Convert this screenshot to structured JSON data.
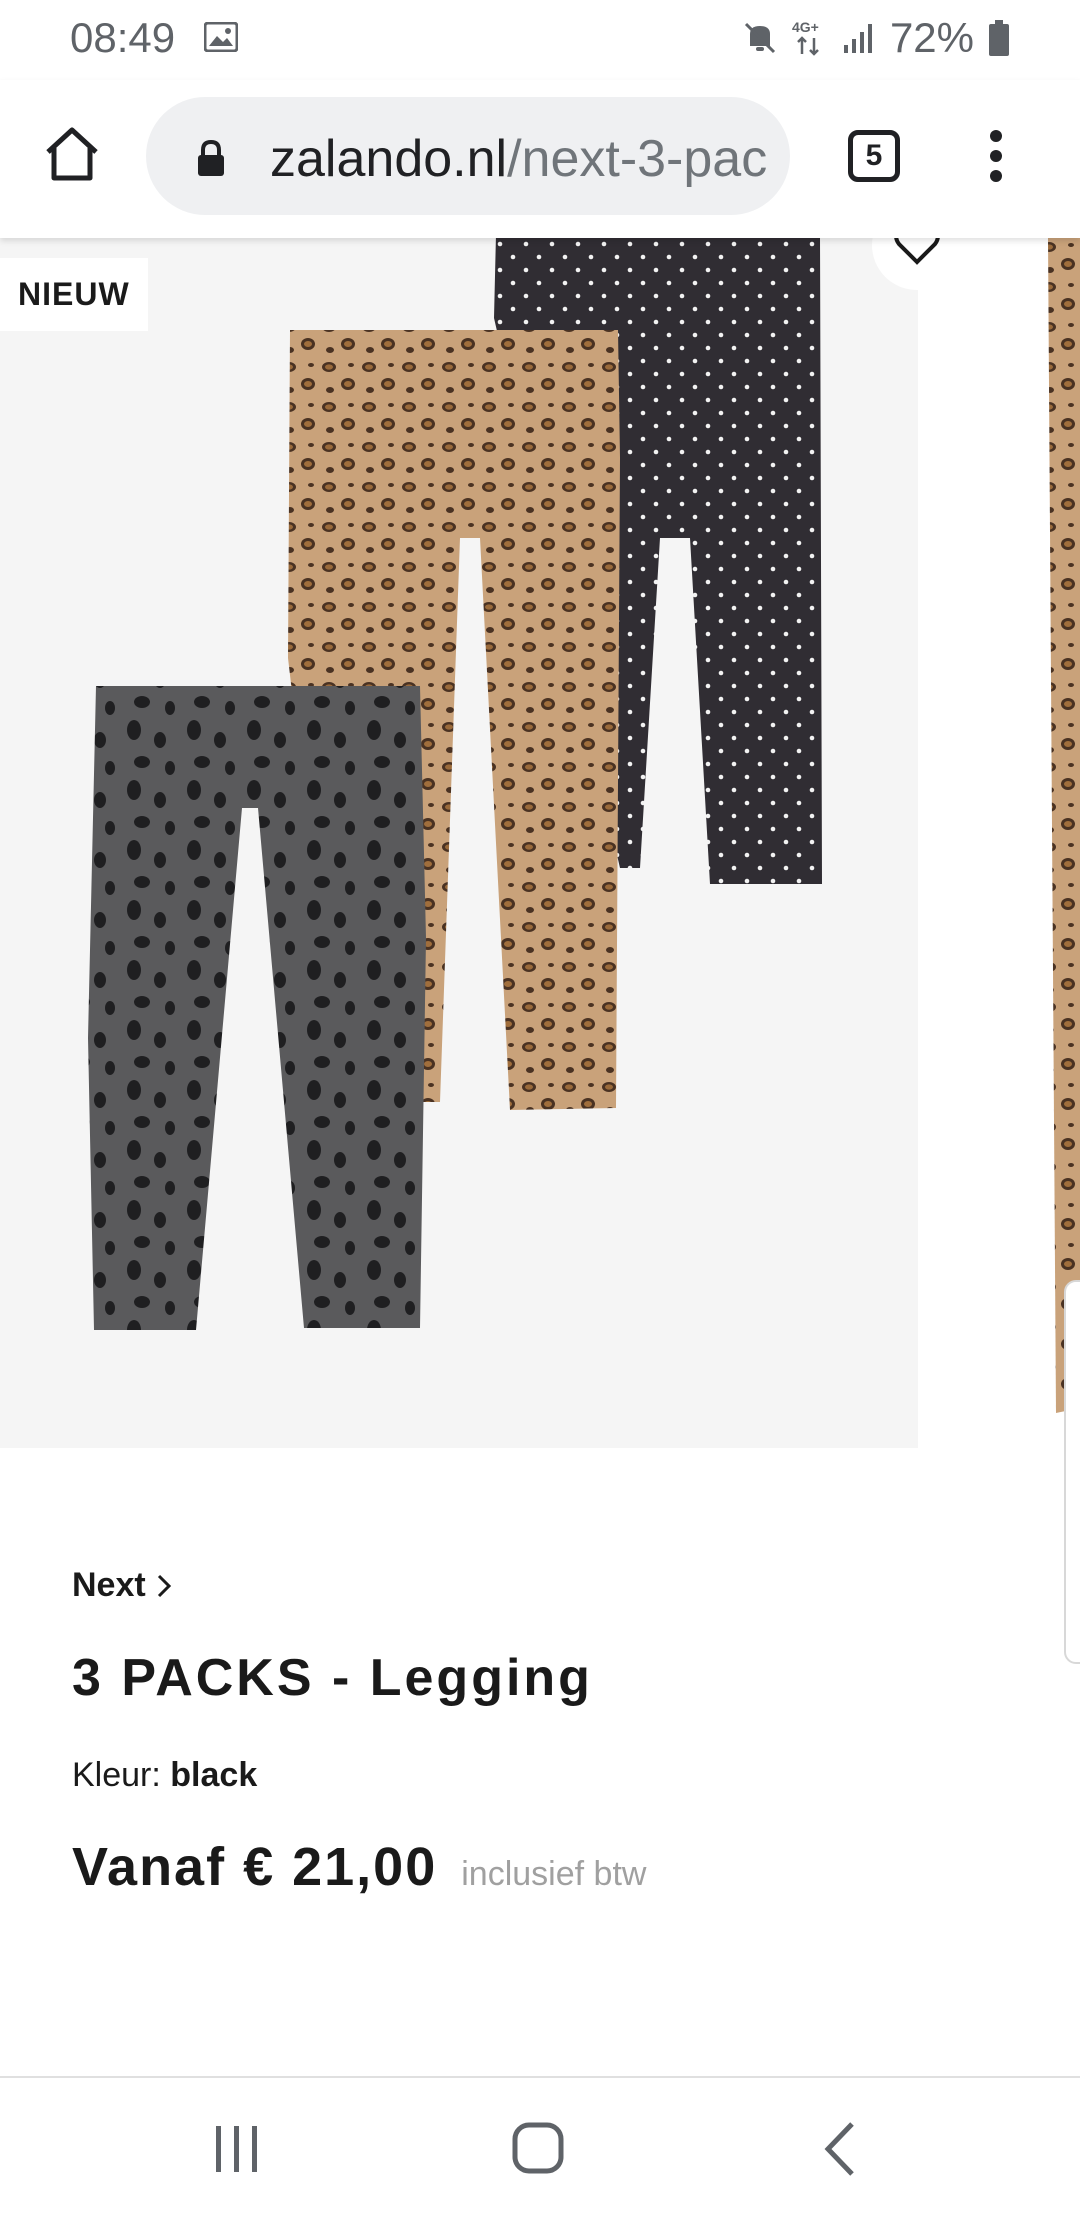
{
  "status_bar": {
    "time": "08:49",
    "battery": "72%",
    "icons": [
      "image-icon",
      "mute-icon",
      "network-4g-icon",
      "signal-icon",
      "battery-icon"
    ]
  },
  "browser": {
    "url_host": "zalando.nl",
    "url_path": "/next-3-pac",
    "tab_count": "5",
    "icons": [
      "home-icon",
      "lock-icon",
      "tabs-icon",
      "more-vert-icon"
    ]
  },
  "product": {
    "badge": "NIEUW",
    "brand": "Next",
    "title": "3 PACKS - Legging",
    "color_label": "Kleur:",
    "color_value": "black",
    "price": "Vanaf € 21,00",
    "vat_note": "inclusief btw"
  },
  "nav": {
    "icons": [
      "recent-apps-icon",
      "home-circle-icon",
      "back-icon"
    ]
  },
  "colors": {
    "image_bg": "#f5f5f5",
    "text": "#1a1a1a",
    "muted": "#a0a0a0",
    "url_pill": "#eff0f2"
  }
}
